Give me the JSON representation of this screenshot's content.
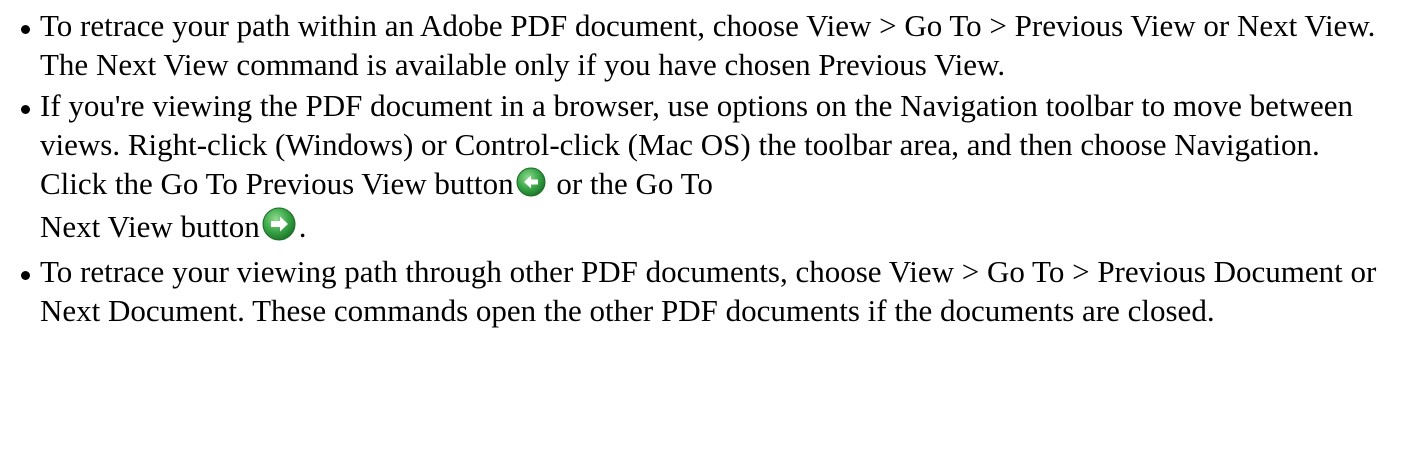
{
  "items": [
    {
      "text": "To retrace your path within an Adobe PDF document, choose View > Go To > Previous View or Next View. The Next View command is available only if you have chosen Previous View."
    },
    {
      "text_part1": "If you're viewing the PDF document in a browser, use options on the Navigation toolbar to move between views. Right-click (Windows) or Control-click (Mac OS) the toolbar area, and then choose Navigation. Click the Go To Previous View button",
      "icon1": "go-to-previous-view-icon",
      "text_part2": " or the Go To Next View button",
      "icon2": "go-to-next-view-icon",
      "text_part3": "."
    },
    {
      "text": "To retrace your viewing path through other PDF documents, choose View > Go To > Previous Document or Next Document. These commands open the other PDF documents if the documents are closed."
    }
  ],
  "colors": {
    "icon_green": "#2e9a3c",
    "icon_highlight": "#7ed184",
    "text": "#000000"
  }
}
